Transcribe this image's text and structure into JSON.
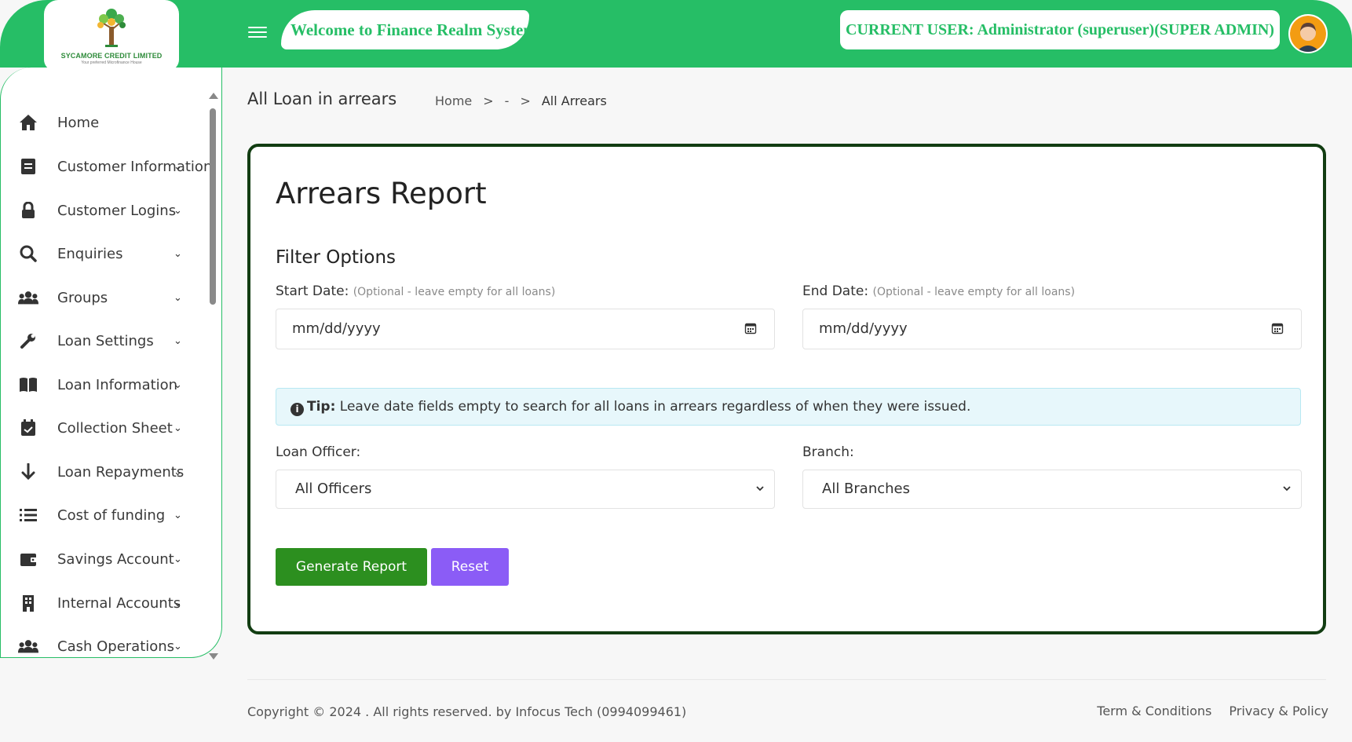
{
  "header": {
    "logo_name": "SYCAMORE CREDIT LIMITED",
    "logo_tagline": "Your preferred Microfinance House",
    "welcome": "Welcome to Finance Realm System",
    "current_user": "CURRENT USER: Administrator (superuser)(SUPER ADMIN)",
    "brand_color": "#26be66"
  },
  "sidebar": {
    "items": [
      {
        "label": "Home",
        "icon": "home-icon",
        "has_chevron": false
      },
      {
        "label": "Customer Information",
        "icon": "document-icon",
        "has_chevron": true
      },
      {
        "label": "Customer Logins",
        "icon": "lock-icon",
        "has_chevron": true
      },
      {
        "label": "Enquiries",
        "icon": "search-icon",
        "has_chevron": true
      },
      {
        "label": "Groups",
        "icon": "users-icon",
        "has_chevron": true
      },
      {
        "label": "Loan Settings",
        "icon": "wrench-icon",
        "has_chevron": true
      },
      {
        "label": "Loan Information",
        "icon": "book-icon",
        "has_chevron": true
      },
      {
        "label": "Collection Sheet",
        "icon": "calendar-check-icon",
        "has_chevron": true
      },
      {
        "label": "Loan Repayments",
        "icon": "arrow-down-icon",
        "has_chevron": true
      },
      {
        "label": "Cost of funding",
        "icon": "list-icon",
        "has_chevron": true
      },
      {
        "label": "Savings Account",
        "icon": "wallet-icon",
        "has_chevron": true
      },
      {
        "label": "Internal Accounts",
        "icon": "building-icon",
        "has_chevron": true
      },
      {
        "label": "Cash Operations",
        "icon": "users-icon",
        "has_chevron": true
      }
    ]
  },
  "page": {
    "title": "All Loan in arrears",
    "breadcrumb": [
      "Home",
      ">",
      "-",
      ">",
      "All Arrears"
    ]
  },
  "card": {
    "title": "Arrears Report",
    "filter_title": "Filter Options",
    "start_label": "Start Date:",
    "end_label": "End Date:",
    "optional_note": "(Optional - leave empty for all loans)",
    "date_placeholder": "mm/dd/yyyy",
    "tip_label": "Tip:",
    "tip_text": "Leave date fields empty to search for all loans in arrears regardless of when they were issued.",
    "officer_label": "Loan Officer:",
    "officer_value": "All Officers",
    "branch_label": "Branch:",
    "branch_value": "All Branches",
    "generate_label": "Generate Report",
    "reset_label": "Reset",
    "generate_color": "#2c8f1f",
    "reset_color": "#8b5cf6"
  },
  "footer": {
    "copyright": "Copyright © 2024 . All rights reserved. by Infocus Tech (0994099461)",
    "terms": "Term & Conditions",
    "privacy": "Privacy & Policy"
  }
}
